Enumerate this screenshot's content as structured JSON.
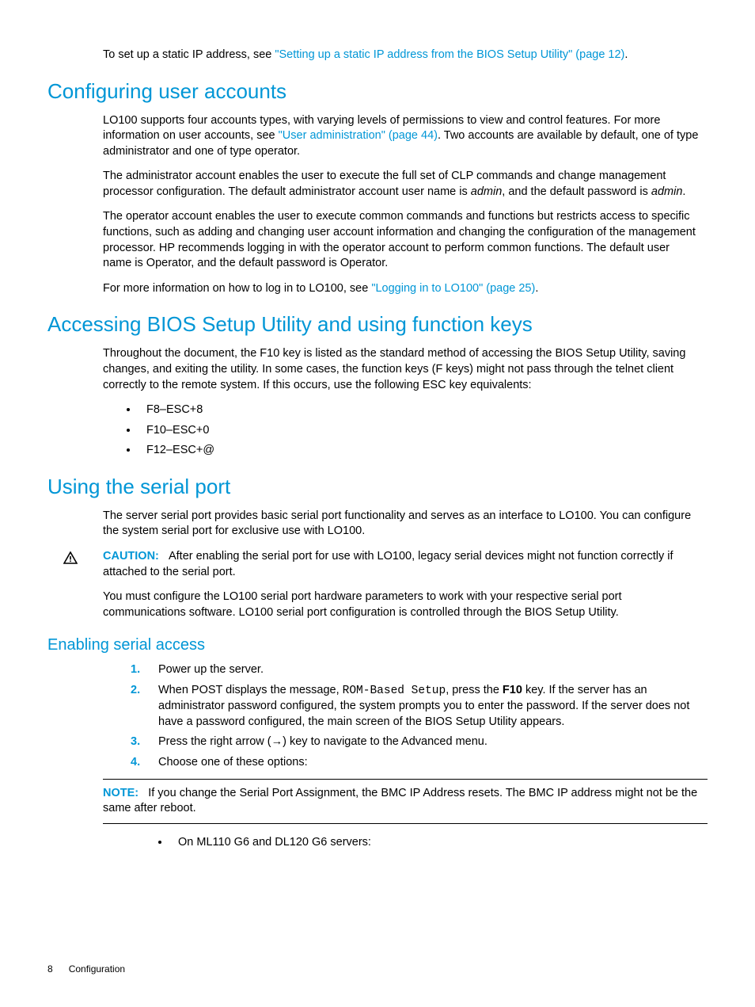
{
  "intro": {
    "p1_a": "To set up a static IP address, see ",
    "p1_link": "\"Setting up a static IP address from the BIOS Setup Utility\" (page 12)",
    "p1_b": "."
  },
  "section1": {
    "title": "Configuring user accounts",
    "p1_a": "LO100 supports four accounts types, with varying levels of permissions to view and control features. For more information on user accounts, see ",
    "p1_link": "\"User administration\" (page 44)",
    "p1_b": ". Two accounts are available by default, one of type administrator and one of type operator.",
    "p2_a": "The administrator account enables the user to execute the full set of CLP commands and change management processor configuration. The default administrator account user name is ",
    "p2_i1": "admin",
    "p2_b": ", and the default password is ",
    "p2_i2": "admin",
    "p2_c": ".",
    "p3": "The operator account enables the user to execute common commands and functions but restricts access to specific functions, such as adding and changing user account information and changing the configuration of the management processor. HP recommends logging in with the operator account to perform common functions. The default user name is Operator, and the default password is Operator.",
    "p4_a": "For more information on how to log in to LO100, see ",
    "p4_link": "\"Logging in to LO100\" (page 25)",
    "p4_b": "."
  },
  "section2": {
    "title": "Accessing BIOS Setup Utility and using function keys",
    "p1": "Throughout the document, the F10 key is listed as the standard method of accessing the BIOS Setup Utility, saving changes, and exiting the utility. In some cases, the function keys (F keys) might not pass through the telnet client correctly to the remote system. If this occurs, use the following ESC key equivalents:",
    "li1": "F8–ESC+8",
    "li2": "F10–ESC+0",
    "li3": "F12–ESC+@"
  },
  "section3": {
    "title": "Using the serial port",
    "p1": "The server serial port provides basic serial port functionality and serves as an interface to LO100. You can configure the system serial port for exclusive use with LO100.",
    "caution_label": "CAUTION:",
    "caution_text": "After enabling the serial port for use with LO100, legacy serial devices might not function correctly if attached to the serial port.",
    "p2": "You must configure the LO100 serial port hardware parameters to work with your respective serial port communications software. LO100 serial port configuration is controlled through the BIOS Setup Utility."
  },
  "section4": {
    "title": "Enabling serial access",
    "step1": "Power up the server.",
    "step2_a": "When POST displays the message, ",
    "step2_mono": "ROM-Based Setup",
    "step2_b": ", press the ",
    "step2_bold": "F10",
    "step2_c": " key. If the server has an administrator password configured, the system prompts you to enter the password. If the server does not have a password configured, the main screen of the BIOS Setup Utility appears.",
    "step3": "Press the right arrow (→) key to navigate to the Advanced menu.",
    "step4": "Choose one of these options:",
    "note_label": "NOTE:",
    "note_text": "If you change the Serial Port Assignment, the BMC IP Address resets. The BMC IP address might not be the same after reboot.",
    "sub1": "On ML110 G6 and DL120 G6 servers:"
  },
  "footer": {
    "page": "8",
    "section": "Configuration"
  }
}
